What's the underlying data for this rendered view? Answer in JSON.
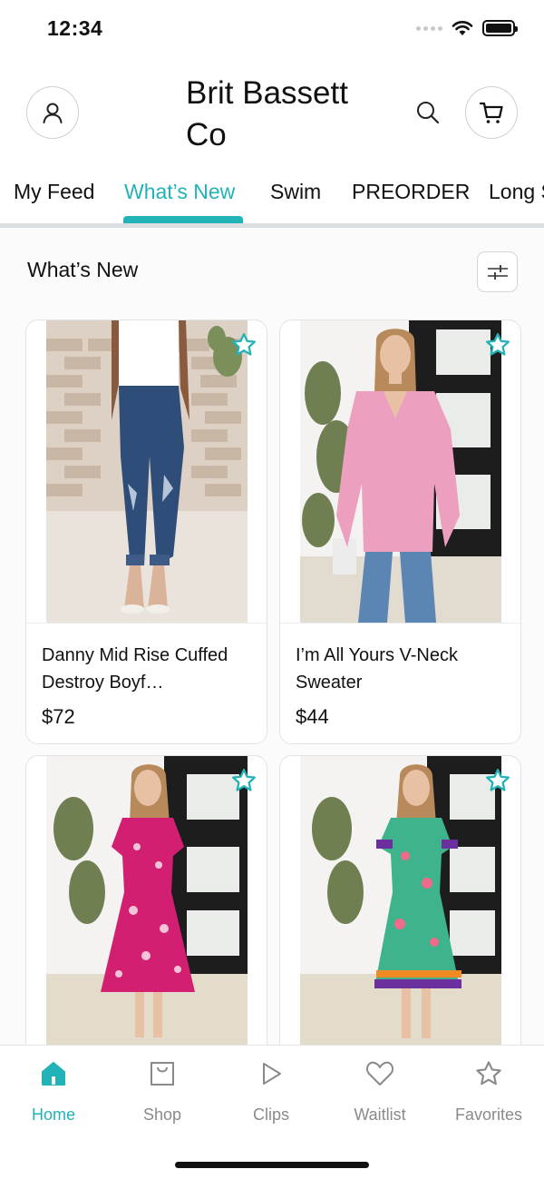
{
  "status_bar": {
    "time": "12:34",
    "icons": [
      "signal-dots-icon",
      "wifi-icon",
      "battery-icon"
    ]
  },
  "header": {
    "title": "Brit Bassett Co",
    "icons": [
      "profile-icon",
      "search-icon",
      "cart-icon"
    ]
  },
  "tabs": [
    {
      "label": "My Feed",
      "active": false
    },
    {
      "label": "What’s New",
      "active": true
    },
    {
      "label": "Swim",
      "active": false
    },
    {
      "label": "PREORDER",
      "active": false
    },
    {
      "label": "Long Sleeve",
      "active": false
    }
  ],
  "section": {
    "title": "What’s New",
    "filter_icon": "sliders-icon"
  },
  "products": [
    {
      "name": "Danny Mid Rise Cuffed Destroy Boyf…",
      "price": "$72",
      "favorite_icon": "star-outline-icon"
    },
    {
      "name": "I’m All Yours V-Neck Sweater",
      "price": "$44",
      "favorite_icon": "star-outline-icon"
    },
    {
      "name": "",
      "price": "",
      "favorite_icon": "star-outline-icon"
    },
    {
      "name": "",
      "price": "",
      "favorite_icon": "star-outline-icon"
    }
  ],
  "bottom_nav": [
    {
      "label": "Home",
      "icon": "home-icon",
      "active": true
    },
    {
      "label": "Shop",
      "icon": "shopping-bag-icon",
      "active": false
    },
    {
      "label": "Clips",
      "icon": "play-icon",
      "active": false
    },
    {
      "label": "Waitlist",
      "icon": "heart-icon",
      "active": false
    },
    {
      "label": "Favorites",
      "icon": "star-icon",
      "active": false
    }
  ],
  "colors": {
    "accent": "#21b3b7",
    "text": "#111111",
    "muted": "#8a8a8a",
    "divider": "#dcdfe2"
  }
}
